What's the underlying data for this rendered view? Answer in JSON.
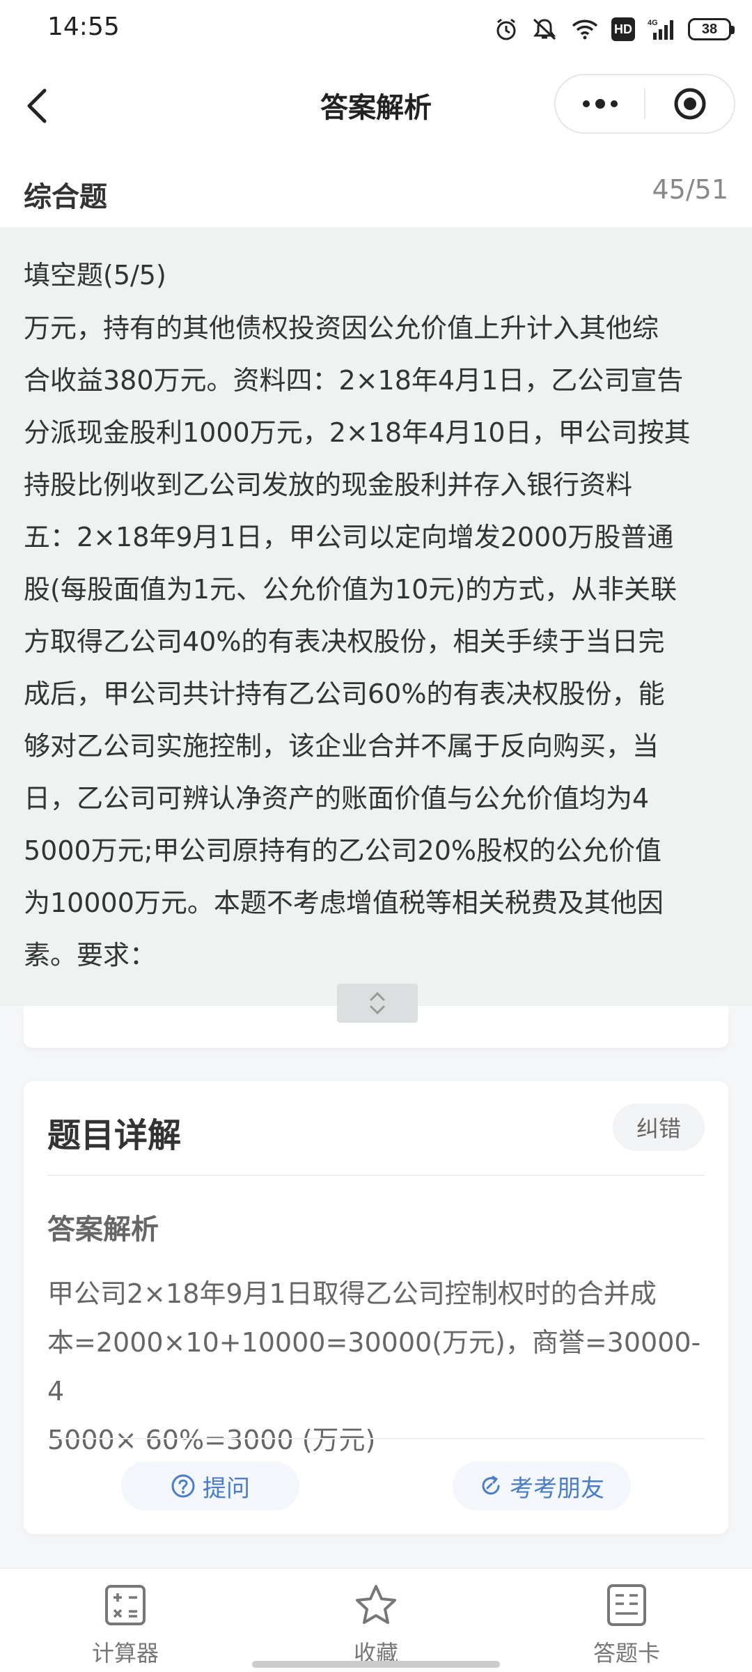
{
  "status_bar": {
    "time": "14:55",
    "battery": "38",
    "network": "4G",
    "hd": "HD"
  },
  "nav": {
    "title": "答案解析"
  },
  "section": {
    "title": "综合题",
    "count": "45/51"
  },
  "question": {
    "type_label": "填空题(5/5)",
    "text_lines": [
      "万元，持有的其他债权投资因公允价值上升计入其他综",
      "合收益380万元。资料四：2×18年4月1日，乙公司宣告",
      "分派现金股利1000万元，2×18年4月10日，甲公司按其",
      "持股比例收到乙公司发放的现金股利并存入银行资料",
      "五：2×18年9月1日，甲公司以定向增发2000万股普通",
      "股(每股面值为1元、公允价值为10元)的方式，从非关联",
      "方取得乙公司40%的有表决权股份，相关手续于当日完",
      "成后，甲公司共计持有乙公司60%的有表决权股份，能",
      "够对乙公司实施控制，该企业合并不属于反向购买，当",
      "日，乙公司可辨认净资产的账面价值与公允价值均为4",
      "5000万元;甲公司原持有的乙公司20%股权的公允价值",
      "为10000万元。本题不考虑增值税等相关税费及其他因",
      "素。要求："
    ]
  },
  "detail": {
    "title": "题目详解",
    "report_label": "纠错",
    "analysis_label": "答案解析",
    "analysis_lines": [
      "甲公司2×18年9月1日取得乙公司控制权时的合并成",
      "本=2000×10+10000=30000(万元)，商誉=30000-4",
      "5000× 60%=3000 (万元)"
    ],
    "ask_label": "提问",
    "friend_label": "考考朋友"
  },
  "tabs": [
    {
      "label": "计算器",
      "icon": "calculator-icon"
    },
    {
      "label": "收藏",
      "icon": "star-icon"
    },
    {
      "label": "答题卡",
      "icon": "answer-card-icon"
    }
  ],
  "colors": {
    "accent_blue": "#4a7cc8",
    "panel_bg": "#eef2f1",
    "page_bg": "#f5f6f8"
  }
}
